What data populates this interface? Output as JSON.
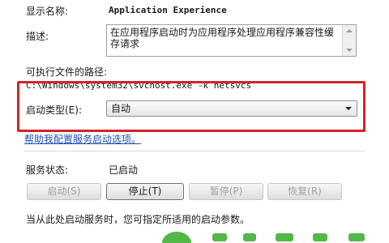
{
  "general": {
    "display_name_label": "显示名称:",
    "display_name_value": "Application Experience",
    "description_label": "描述:",
    "description_value": "在应用程序启动时为应用程序处理应用程序兼容性缓存请求",
    "exe_path_label": "可执行文件的路径:",
    "exe_path_value": "C:\\Windows\\system32\\svchost.exe -k netsvcs",
    "startup_type_label": "启动类型(E):",
    "startup_type_value": "自动",
    "help_link": "帮助我配置服务启动选项。"
  },
  "status": {
    "label": "服务状态:",
    "value": "已启动"
  },
  "buttons": {
    "start": "启动(S)",
    "stop": "停止(T)",
    "pause": "暂停(P)",
    "resume": "恢复(R)"
  },
  "hint": "当从此处启动服务时，您可指定所适用的启动参数。",
  "colors": {
    "highlight": "#d2232a",
    "link": "#1f4fb5",
    "watermark": "#52b847"
  }
}
